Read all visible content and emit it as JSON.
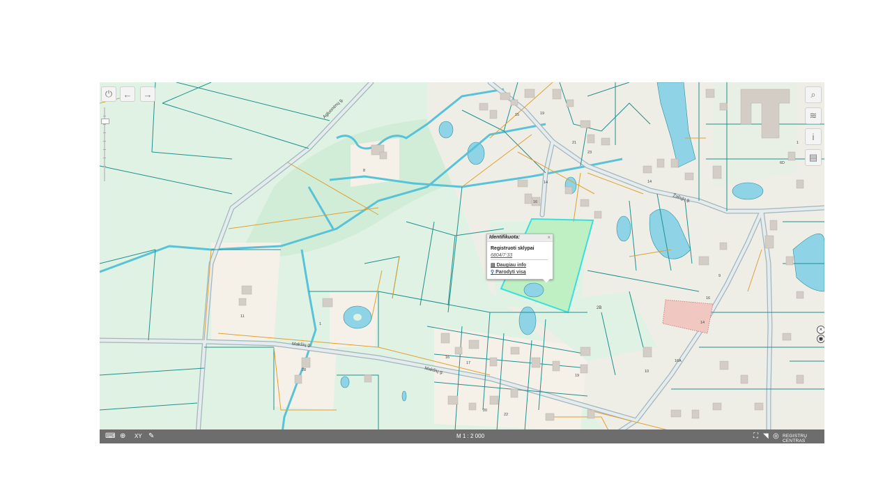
{
  "map": {
    "street_labels": [
      "Agluonėnų g.",
      "Žaliųjų g.",
      "Makšių g.",
      "Makšių g."
    ],
    "house_numbers": [
      "8",
      "1",
      "11",
      "1",
      "14",
      "16",
      "1",
      "2",
      "15",
      "19",
      "21",
      "23",
      "8",
      "2",
      "1",
      "12",
      "14",
      "6",
      "6D",
      "1",
      "5",
      "28",
      "7",
      "15",
      "17",
      "9",
      "1",
      "12",
      "14",
      "16",
      "16A",
      "10",
      "13",
      "15",
      "11",
      "17",
      "19",
      "17",
      "16",
      "19A",
      "18",
      "2B",
      "12",
      "14",
      "16",
      "18",
      "20",
      "22"
    ],
    "parcel_label": "2B",
    "colors": {
      "land": "#dff2e3",
      "parcel_line": "#1f8f8f",
      "boundary_line": "#e0a030",
      "water": "#8fd3e6",
      "road": "#cfd8dc",
      "building": "#d3cdc6",
      "selected_parcel": "#bff0c4",
      "selected_outline": "#37e0dc"
    }
  },
  "popup": {
    "header": "Identifikuota:",
    "close": "×",
    "layer_name": "Registruoti sklypai",
    "parcel_id": "6804/7:33",
    "more_info": "Daugiau info",
    "show_all": "Parodyti visą"
  },
  "toolbar": {
    "power_icon": "⏻",
    "back_icon": "←",
    "forward_icon": "→",
    "search_icon": "⌕",
    "layers_icon": "≋",
    "info_icon": "i",
    "legend_icon": "▤"
  },
  "bottom_bar": {
    "keyboard_icon": "⌨",
    "add_doc_icon": "⊕",
    "xy_label": "XY",
    "eraser_icon": "✎",
    "scale": "M 1 : 2 000",
    "fullscreen_icon": "⛶",
    "wifi_icon": "◥",
    "brand_icon": "◎",
    "brand": "REGISTRŲ CENTRAS"
  },
  "side_controls": {
    "close_icon": "×",
    "locate_icon": "◉"
  }
}
